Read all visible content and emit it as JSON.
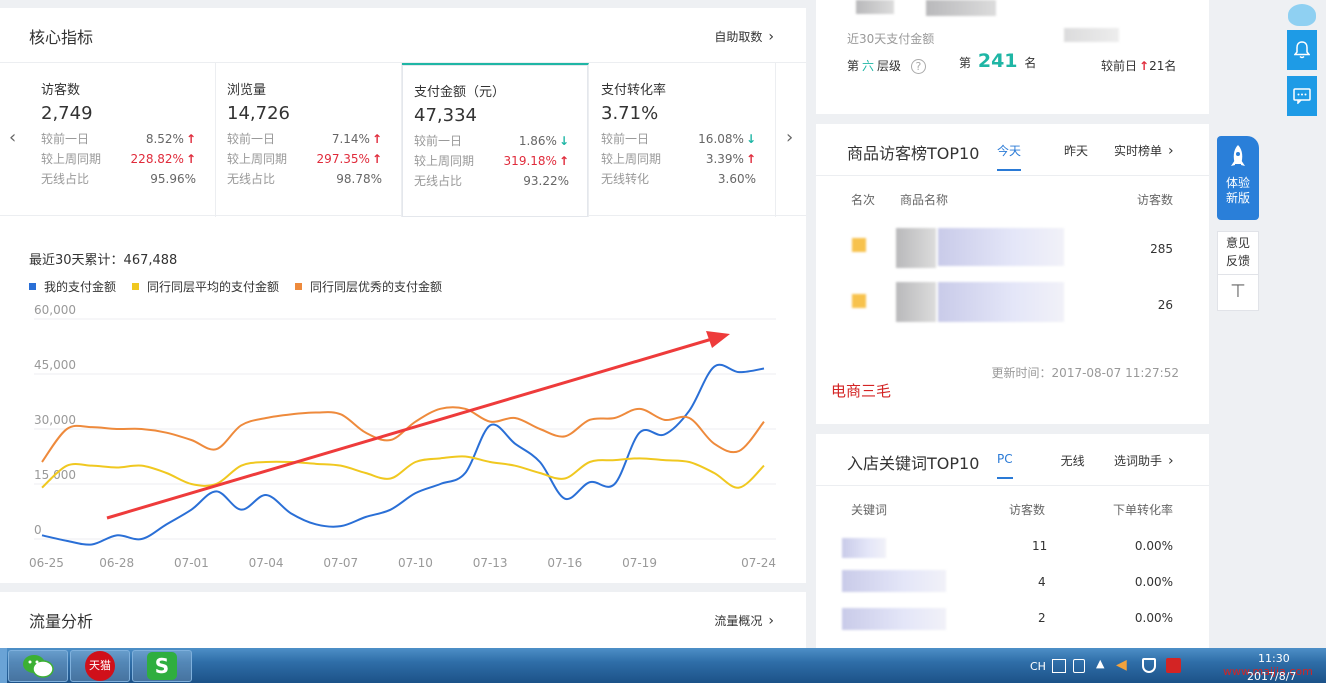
{
  "core": {
    "title": "核心指标",
    "link": "自助取数",
    "metrics": [
      {
        "name": "访客数",
        "value": "2,749",
        "rows": [
          {
            "label": "较前一日",
            "val": "8.52%",
            "dir": "up",
            "red": false
          },
          {
            "label": "较上周同期",
            "val": "228.82%",
            "dir": "up",
            "red": true
          },
          {
            "label": "无线占比",
            "val": "95.96%",
            "dir": "",
            "red": false
          }
        ]
      },
      {
        "name": "浏览量",
        "value": "14,726",
        "rows": [
          {
            "label": "较前一日",
            "val": "7.14%",
            "dir": "up",
            "red": false
          },
          {
            "label": "较上周同期",
            "val": "297.35%",
            "dir": "up",
            "red": true
          },
          {
            "label": "无线占比",
            "val": "98.78%",
            "dir": "",
            "red": false
          }
        ]
      },
      {
        "name": "支付金额（元）",
        "value": "47,334",
        "rows": [
          {
            "label": "较前一日",
            "val": "1.86%",
            "dir": "down",
            "red": false
          },
          {
            "label": "较上周同期",
            "val": "319.18%",
            "dir": "up",
            "red": true
          },
          {
            "label": "无线占比",
            "val": "93.22%",
            "dir": "",
            "red": false
          }
        ]
      },
      {
        "name": "支付转化率",
        "value": "3.71%",
        "rows": [
          {
            "label": "较前一日",
            "val": "16.08%",
            "dir": "down",
            "red": false
          },
          {
            "label": "较上周同期",
            "val": "3.39%",
            "dir": "up",
            "red": false
          },
          {
            "label": "无线转化",
            "val": "3.60%",
            "dir": "",
            "red": false
          }
        ]
      }
    ],
    "cumulative": "最近30天累计：467,488"
  },
  "chart_data": {
    "type": "line",
    "x": [
      "06-25",
      "06-26",
      "06-27",
      "06-28",
      "06-29",
      "06-30",
      "07-01",
      "07-02",
      "07-03",
      "07-04",
      "07-05",
      "07-06",
      "07-07",
      "07-08",
      "07-09",
      "07-10",
      "07-11",
      "07-12",
      "07-13",
      "07-14",
      "07-15",
      "07-16",
      "07-17",
      "07-18",
      "07-19",
      "07-20",
      "07-21",
      "07-22",
      "07-23",
      "07-24"
    ],
    "xticks": [
      "06-25",
      "06-28",
      "07-01",
      "07-04",
      "07-07",
      "07-10",
      "07-13",
      "07-16",
      "07-19",
      "07-24"
    ],
    "yticks": [
      "60,000",
      "45,000",
      "30,000",
      "15,000",
      "0"
    ],
    "ylim": [
      0,
      60000
    ],
    "series": [
      {
        "name": "我的支付金额",
        "color": "#2a6fd6",
        "values": [
          1000,
          -500,
          -1500,
          1000,
          0,
          4000,
          8000,
          13000,
          8000,
          12000,
          7000,
          4000,
          3500,
          6000,
          8000,
          12500,
          15000,
          18000,
          31000,
          26000,
          21000,
          11000,
          15500,
          15000,
          29000,
          28500,
          35000,
          47000,
          45500,
          46500
        ]
      },
      {
        "name": "同行同层平均的支付金额",
        "color": "#f0c820",
        "values": [
          14000,
          20000,
          20000,
          19500,
          20000,
          18000,
          15000,
          15000,
          20000,
          21000,
          21000,
          20500,
          20000,
          18000,
          16500,
          21000,
          22000,
          22500,
          21000,
          20000,
          18000,
          16500,
          21000,
          21500,
          22000,
          21500,
          21000,
          18000,
          14000,
          20000
        ]
      },
      {
        "name": "同行同层优秀的支付金额",
        "color": "#ee8a3c",
        "values": [
          21000,
          30000,
          30500,
          30000,
          30000,
          29000,
          27000,
          24500,
          31000,
          33000,
          34000,
          34500,
          34000,
          29000,
          27000,
          32000,
          35500,
          35500,
          32000,
          33000,
          30000,
          28000,
          32500,
          33000,
          35500,
          32500,
          33000,
          26000,
          24000,
          32000
        ]
      }
    ]
  },
  "traffic": {
    "title": "流量分析",
    "link": "流量概况"
  },
  "topcard": {
    "label": "近30天支付金额",
    "tier_prefix": "第",
    "tier_num": "六",
    "tier_suffix": "层级",
    "rank_prefix": "第",
    "rank": "241",
    "rank_suffix": "名",
    "compare": "较前日",
    "compare_val": "21名"
  },
  "goods": {
    "title": "商品访客榜TOP10",
    "tabs": [
      "今天",
      "昨天"
    ],
    "link": "实时榜单",
    "headers": [
      "名次",
      "商品名称",
      "访客数"
    ],
    "rows": [
      {
        "visitors": "285"
      },
      {
        "visitors": "26"
      }
    ],
    "updated": "更新时间：2017-08-07 11:27:52",
    "watermark": "电商三毛"
  },
  "keywords": {
    "title": "入店关键词TOP10",
    "tabs": [
      "PC",
      "无线"
    ],
    "link": "选词助手",
    "headers": [
      "关键词",
      "访客数",
      "下单转化率"
    ],
    "rows": [
      {
        "visitors": "11",
        "rate": "0.00%"
      },
      {
        "visitors": "4",
        "rate": "0.00%"
      },
      {
        "visitors": "2",
        "rate": "0.00%"
      }
    ]
  },
  "sidebar": {
    "rocket_label_1": "体验",
    "rocket_label_2": "新版",
    "feedback_1": "意见",
    "feedback_2": "反馈"
  },
  "taskbar": {
    "app2": "天猫",
    "ime": "CH",
    "time": "11:30",
    "date": "2017/8/7",
    "watermark": "www.maijia.com"
  }
}
